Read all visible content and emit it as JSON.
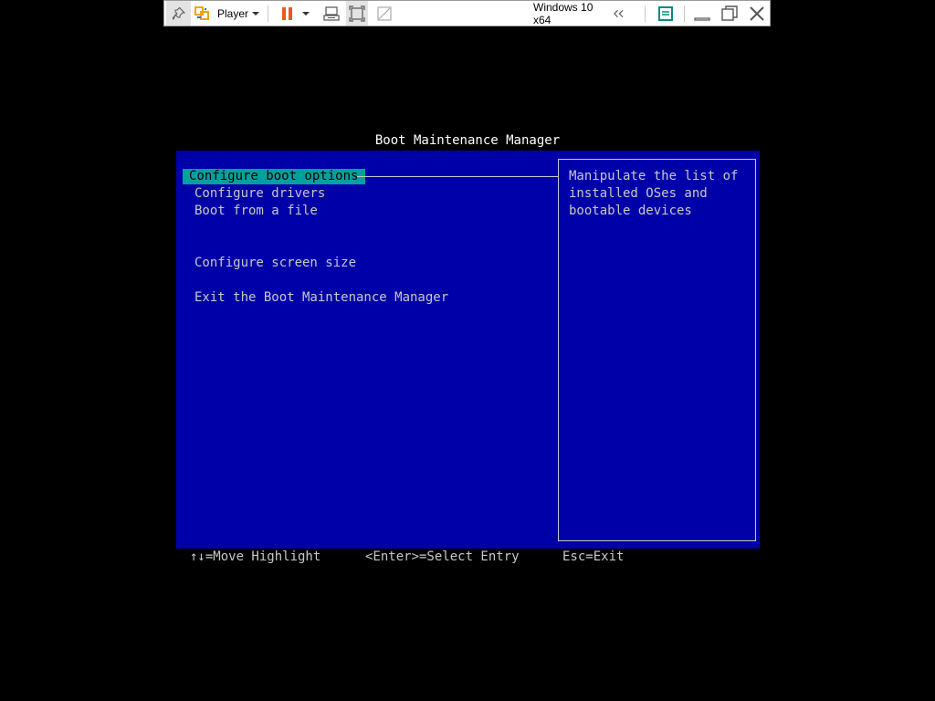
{
  "toolbar": {
    "player_label": "Player",
    "vm_name": "Windows 10 x64",
    "icons": [
      "pin-icon",
      "player-logo-icon",
      "pause-icon",
      "send-ctrl-alt-del-icon",
      "fit-window-icon",
      "unity-icon",
      "back-arrows-icon",
      "message-log-icon",
      "minimize-icon",
      "restore-icon",
      "close-icon"
    ],
    "accent_pause": "#e85a1b",
    "accent_logo": "#f0a500"
  },
  "bios": {
    "title": "Boot Maintenance Manager",
    "background": "#0000a8",
    "highlight": "#00a0a0",
    "menu": [
      "Configure boot options",
      "Configure drivers",
      "Boot from a file",
      "Configure screen size",
      "Exit the Boot Maintenance Manager"
    ],
    "help": [
      "Manipulate the list of",
      "installed OSes and",
      "bootable devices"
    ],
    "footer": {
      "move": "↑↓=Move Highlight",
      "select": "<Enter>=Select Entry",
      "exit": "Esc=Exit"
    }
  }
}
